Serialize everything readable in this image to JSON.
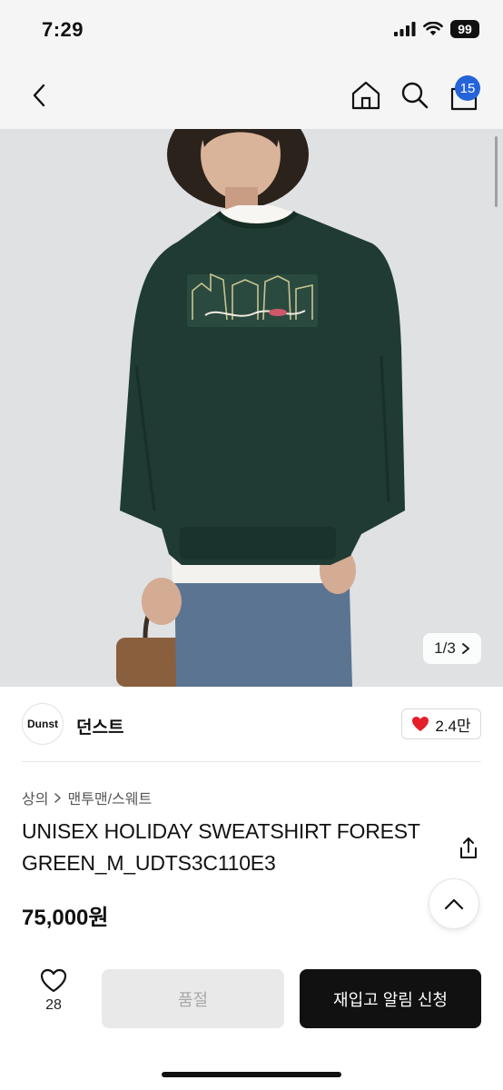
{
  "status_bar": {
    "time": "7:29",
    "battery": "99"
  },
  "nav": {
    "cart_count": "15",
    "icons": [
      "back-chevron-icon",
      "home-icon",
      "search-icon",
      "shopping-bag-icon"
    ]
  },
  "gallery": {
    "counter": "1/3"
  },
  "brand": {
    "logo_text": "Dunst",
    "name": "던스트",
    "likes": "2.4만"
  },
  "breadcrumb": {
    "category": "상의",
    "subcategory": "맨투맨/스웨트"
  },
  "product": {
    "title": "UNISEX HOLIDAY SWEATSHIRT FOREST GREEN_M_UDTS3C110E3",
    "price": "75,000원"
  },
  "bottom_bar": {
    "wish_count": "28",
    "soldout_label": "품절",
    "restock_label": "재입고 알림 신청"
  },
  "colors": {
    "accent_blue": "#2563d8",
    "like_red": "#e3202a",
    "sweatshirt_green": "#1f3b33",
    "primary_black": "#111111",
    "disabled_gray": "#e9e9e9"
  }
}
